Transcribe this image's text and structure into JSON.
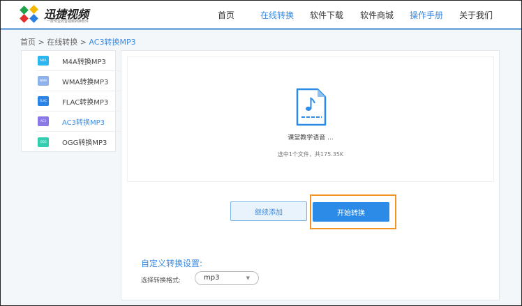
{
  "header": {
    "brand": "迅捷视频",
    "slogan": "一款专业的音视频转换软件",
    "nav": [
      {
        "label": "首页",
        "active": false
      },
      {
        "label": "在线转换",
        "active": true
      },
      {
        "label": "软件下载",
        "active": false
      },
      {
        "label": "软件商城",
        "active": false
      },
      {
        "label": "操作手册",
        "active": true
      },
      {
        "label": "关于我们",
        "active": false
      }
    ]
  },
  "breadcrumb": {
    "home": "首页",
    "sep": ">",
    "section": "在线转换",
    "current": "AC3转换MP3"
  },
  "sidebar": {
    "items": [
      {
        "label": "M4A转换MP3",
        "icon": "M4A",
        "color": "#2db7f0"
      },
      {
        "label": "WMA转换MP3",
        "icon": "WMA",
        "color": "#8fb2ea"
      },
      {
        "label": "FLAC转换MP3",
        "icon": "FLAC",
        "color": "#2c83e6"
      },
      {
        "label": "AC3转换MP3",
        "icon": "AC3",
        "color": "#8a78e8",
        "active": true
      },
      {
        "label": "OGG转换MP3",
        "icon": "OGG",
        "color": "#33cdb0"
      }
    ]
  },
  "upload": {
    "file_name": "课堂教学语音 ...",
    "file_info": "选中1个文件，共175.35K"
  },
  "buttons": {
    "add": "继续添加",
    "start": "开始转换"
  },
  "settings": {
    "title": "自定义转换设置:",
    "format_label": "选择转换格式:",
    "format_value": "mp3"
  }
}
